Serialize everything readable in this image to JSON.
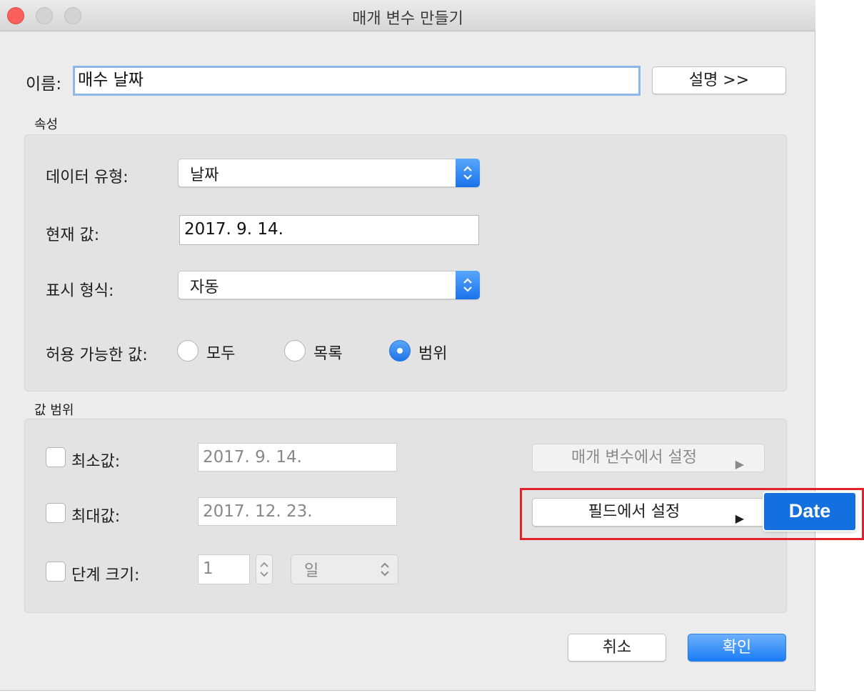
{
  "window": {
    "title": "매개 변수 만들기"
  },
  "name_row": {
    "label": "이름:",
    "value": "매수 날짜",
    "describe_button": "설명 >>"
  },
  "properties": {
    "section_label": "속성",
    "data_type": {
      "label": "데이터 유형:",
      "value": "날짜"
    },
    "current_value": {
      "label": "현재 값:",
      "value": "2017. 9. 14."
    },
    "display_format": {
      "label": "표시 형식:",
      "value": "자동"
    },
    "allowable": {
      "label": "허용 가능한 값:",
      "options": [
        "모두",
        "목록",
        "범위"
      ],
      "selected": "범위"
    }
  },
  "range": {
    "section_label": "값 범위",
    "min": {
      "label": "최소값:",
      "value": "2017. 9. 14.",
      "checked": false
    },
    "max": {
      "label": "최대값:",
      "value": "2017. 12. 23.",
      "checked": false
    },
    "step": {
      "label": "단계 크기:",
      "value": "1",
      "unit": "일",
      "checked": false
    },
    "set_from_parameter": "매개 변수에서 설정",
    "set_from_field": "필드에서 설정",
    "arrow": "▶",
    "field_popup_item": "Date"
  },
  "footer": {
    "cancel": "취소",
    "ok": "확인"
  },
  "colors": {
    "accent": "#1a7cf5",
    "highlight_border": "#e3202b",
    "close_light": "#fc605c"
  }
}
